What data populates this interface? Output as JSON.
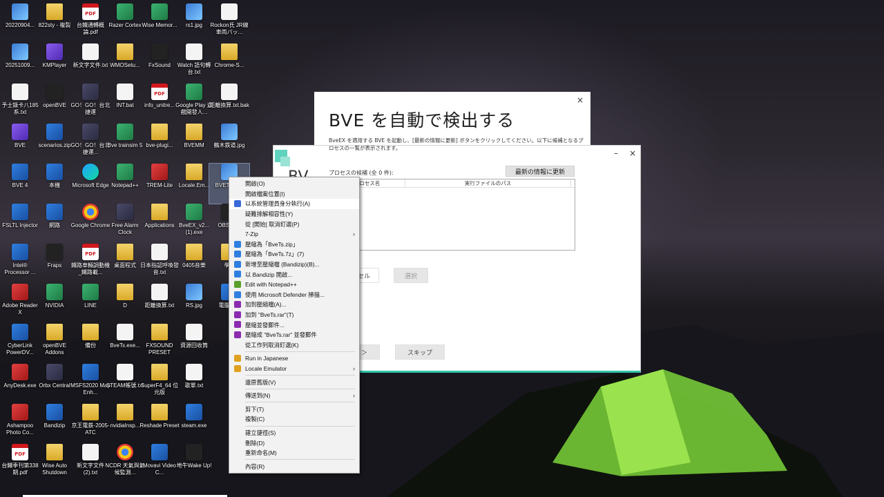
{
  "desktop_icons": [
    {
      "label": "20220904...",
      "type": "img"
    },
    {
      "label": "822sty - 複製",
      "type": "folder"
    },
    {
      "label": "台鐵通轉概論.pdf",
      "type": "pdf"
    },
    {
      "label": "Razer Cortex",
      "type": "green"
    },
    {
      "label": "Wise Memor...",
      "type": "green"
    },
    {
      "label": "rs1.jpg",
      "type": "img"
    },
    {
      "label": "Rockon氏 JR線車両パッ...",
      "type": "file"
    },
    {
      "label": "20251009...",
      "type": "img"
    },
    {
      "label": "KMPlayer",
      "type": "purple"
    },
    {
      "label": "新文字文件.txt",
      "type": "file"
    },
    {
      "label": "WMOSetu...",
      "type": "folder"
    },
    {
      "label": "FxSound",
      "type": "dark"
    },
    {
      "label": "Watch 語句轉台.txt",
      "type": "file"
    },
    {
      "label": "Chrome-S...",
      "type": "folder"
    },
    {
      "label": "予士錄卡八185系.txt",
      "type": "file"
    },
    {
      "label": "openBVE",
      "type": "dark"
    },
    {
      "label": "GO！GO！台北捷運",
      "type": "app"
    },
    {
      "label": "INT.bat",
      "type": "file"
    },
    {
      "label": "info_unitre...",
      "type": "pdf"
    },
    {
      "label": "Google Play 遊戲開發人...",
      "type": "green"
    },
    {
      "label": "距離換算.txt.bak",
      "type": "file"
    },
    {
      "label": "BVE",
      "type": "purple"
    },
    {
      "label": "scenarios.zip",
      "type": "blue"
    },
    {
      "label": "GO！GO！台北捷運...",
      "type": "app"
    },
    {
      "label": "Bve trainsim 5",
      "type": "green"
    },
    {
      "label": "bve-plugi...",
      "type": "folder"
    },
    {
      "label": "BVEMM",
      "type": "folder"
    },
    {
      "label": "鶴木鉄道.jpg",
      "type": "img"
    },
    {
      "label": "BVE 4",
      "type": "blue"
    },
    {
      "label": "本機",
      "type": "blue"
    },
    {
      "label": "Microsoft Edge",
      "type": "edge"
    },
    {
      "label": "Notepad++",
      "type": "green"
    },
    {
      "label": "TREM-Lite",
      "type": "red"
    },
    {
      "label": "Locale.Em...",
      "type": "folder"
    },
    {
      "label": "BVETs 整...",
      "type": "img"
    },
    {
      "label": "FSLTL Injector",
      "type": "blue"
    },
    {
      "label": "網路",
      "type": "blue"
    },
    {
      "label": "Google Chrome",
      "type": "chrome"
    },
    {
      "label": "Free Alarm Clock",
      "type": "app"
    },
    {
      "label": "Applications",
      "type": "folder"
    },
    {
      "label": "BveEX_v2... (1).exe",
      "type": "green"
    },
    {
      "label": "OBS St...",
      "type": "dark"
    },
    {
      "label": "Intel® Processor ...",
      "type": "blue"
    },
    {
      "label": "Fraps",
      "type": "dark"
    },
    {
      "label": "鐵路車輛調動機_鐵路載...",
      "type": "pdf"
    },
    {
      "label": "桌面程式",
      "type": "folder"
    },
    {
      "label": "日本指認呼喚發音.txt",
      "type": "file"
    },
    {
      "label": "0405音樂",
      "type": "folder"
    },
    {
      "label": "學...",
      "type": "folder"
    },
    {
      "label": "Adobe Reader X",
      "type": "red"
    },
    {
      "label": "NVIDIA",
      "type": "green"
    },
    {
      "label": "LINE",
      "type": "green"
    },
    {
      "label": "D",
      "type": "folder"
    },
    {
      "label": "距離換算.txt",
      "type": "file"
    },
    {
      "label": "RS.jpg",
      "type": "img"
    },
    {
      "label": "電腦健...",
      "type": "blue"
    },
    {
      "label": "CyberLink PowerDV...",
      "type": "blue"
    },
    {
      "label": "openBVE Addons",
      "type": "folder"
    },
    {
      "label": "備份",
      "type": "folder"
    },
    {
      "label": "BveTs.exe...",
      "type": "file"
    },
    {
      "label": "FXSOUND PRESET",
      "type": "folder"
    },
    {
      "label": "資源回收筒",
      "type": "file"
    },
    {
      "label": "",
      "type": "none"
    },
    {
      "label": "AnyDesk.exe",
      "type": "red"
    },
    {
      "label": "Orbx Central",
      "type": "app"
    },
    {
      "label": "MSFS2020 Map Enh...",
      "type": "blue"
    },
    {
      "label": "STEAM帳號.txt",
      "type": "file"
    },
    {
      "label": "SuperF4_64 位元版",
      "type": "folder"
    },
    {
      "label": "歌單.txt",
      "type": "file"
    },
    {
      "label": "",
      "type": "none"
    },
    {
      "label": "Ashampoo Photo Co...",
      "type": "red"
    },
    {
      "label": "Bandizip",
      "type": "blue"
    },
    {
      "label": "京王電鉄-2005-ATC",
      "type": "folder"
    },
    {
      "label": "nvidiaInsp...",
      "type": "folder"
    },
    {
      "label": "Reshade Preset",
      "type": "folder"
    },
    {
      "label": "steam.exe",
      "type": "blue"
    },
    {
      "label": "",
      "type": "none"
    },
    {
      "label": "台鐵季刊第338期.pdf",
      "type": "pdf"
    },
    {
      "label": "Wise Auto Shutdown",
      "type": "folder"
    },
    {
      "label": "新文字文件(2).txt",
      "type": "file"
    },
    {
      "label": "NCDR 天氣與氣候監測...",
      "type": "chrome"
    },
    {
      "label": "Movavi Video C...",
      "type": "blue"
    },
    {
      "label": "地牛Wake Up!",
      "type": "dark"
    },
    {
      "label": "",
      "type": "none"
    }
  ],
  "back_window": {
    "title": "BVE を自動で検出する",
    "description": "BveEX を適用する BVE を起動し、[最新の情報に更新] ボタンをクリックしてください。以下に候補となるプロセスの一覧が表示されます。",
    "close_glyph": "×"
  },
  "front_window": {
    "title_fragment": "BV",
    "min_glyph": "–",
    "close_glyph": "×",
    "process_label": "プロセスの候補 (全 0 件):",
    "refresh_button": "最新の情報に更新",
    "columns": [
      "プロセス名",
      "実行ファイルのパス"
    ],
    "cancel_fragment": "セル",
    "select_button": "選択",
    "next_fragment": "＞",
    "skip_button": "スキップ"
  },
  "context_menu": {
    "items": [
      {
        "label": "開啟(O)",
        "icon": "",
        "kind": "item"
      },
      {
        "label": "開啟檔案位置(I)",
        "icon": "",
        "kind": "item"
      },
      {
        "label": "以系統管理員身分執行(A)",
        "icon": "shield-icon",
        "kind": "item",
        "highlight": true
      },
      {
        "label": "疑難排解相容性(Y)",
        "icon": "",
        "kind": "item"
      },
      {
        "label": "從 [開始] 取消釘選(P)",
        "icon": "",
        "kind": "item"
      },
      {
        "label": "7-Zip",
        "icon": "",
        "kind": "submenu"
      },
      {
        "label": "壓縮為「BveTs.zip」",
        "icon": "bandizip-icon",
        "kind": "item"
      },
      {
        "label": "壓縮為「BveTs.7z」(7)",
        "icon": "bandizip-icon",
        "kind": "item"
      },
      {
        "label": "新增至壓縮檔 (Bandizip)(B)...",
        "icon": "bandizip-icon",
        "kind": "item"
      },
      {
        "label": "以 Bandizip 開啟...",
        "icon": "bandizip-icon",
        "kind": "item"
      },
      {
        "label": "Edit with Notepad++",
        "icon": "notepad-icon",
        "kind": "item"
      },
      {
        "label": "使用 Microsoft Defender 掃描...",
        "icon": "defender-icon",
        "kind": "item"
      },
      {
        "label": "加到壓縮檔(A)...",
        "icon": "winrar-icon",
        "kind": "item"
      },
      {
        "label": "加到 \"BveTs.rar\"(T)",
        "icon": "winrar-icon",
        "kind": "item"
      },
      {
        "label": "壓縮並發郵件...",
        "icon": "winrar-icon",
        "kind": "item"
      },
      {
        "label": "壓縮成 \"BveTs.rar\" 並發郵件",
        "icon": "winrar-icon",
        "kind": "item"
      },
      {
        "label": "從工作列取消釘選(K)",
        "icon": "",
        "kind": "item"
      },
      {
        "kind": "sep"
      },
      {
        "label": "Run in Japanese",
        "icon": "locale-icon",
        "kind": "item"
      },
      {
        "label": "Locale Emulator",
        "icon": "locale-icon",
        "kind": "submenu"
      },
      {
        "kind": "sep"
      },
      {
        "label": "還原舊版(V)",
        "icon": "",
        "kind": "item"
      },
      {
        "kind": "sep"
      },
      {
        "label": "傳送到(N)",
        "icon": "",
        "kind": "submenu"
      },
      {
        "kind": "sep"
      },
      {
        "label": "剪下(T)",
        "icon": "",
        "kind": "item"
      },
      {
        "label": "複製(C)",
        "icon": "",
        "kind": "item"
      },
      {
        "kind": "sep"
      },
      {
        "label": "建立捷徑(S)",
        "icon": "",
        "kind": "item"
      },
      {
        "label": "刪除(D)",
        "icon": "",
        "kind": "item"
      },
      {
        "label": "重新命名(M)",
        "icon": "",
        "kind": "item"
      },
      {
        "kind": "sep"
      },
      {
        "label": "內容(R)",
        "icon": "",
        "kind": "item"
      }
    ]
  },
  "colors": {
    "accent": "#2fc6a8",
    "menu_bg": "#f2f2f2",
    "bandizip": "#2f7fe0",
    "winrar": "#8b2bb0",
    "locale": "#e0a020"
  }
}
